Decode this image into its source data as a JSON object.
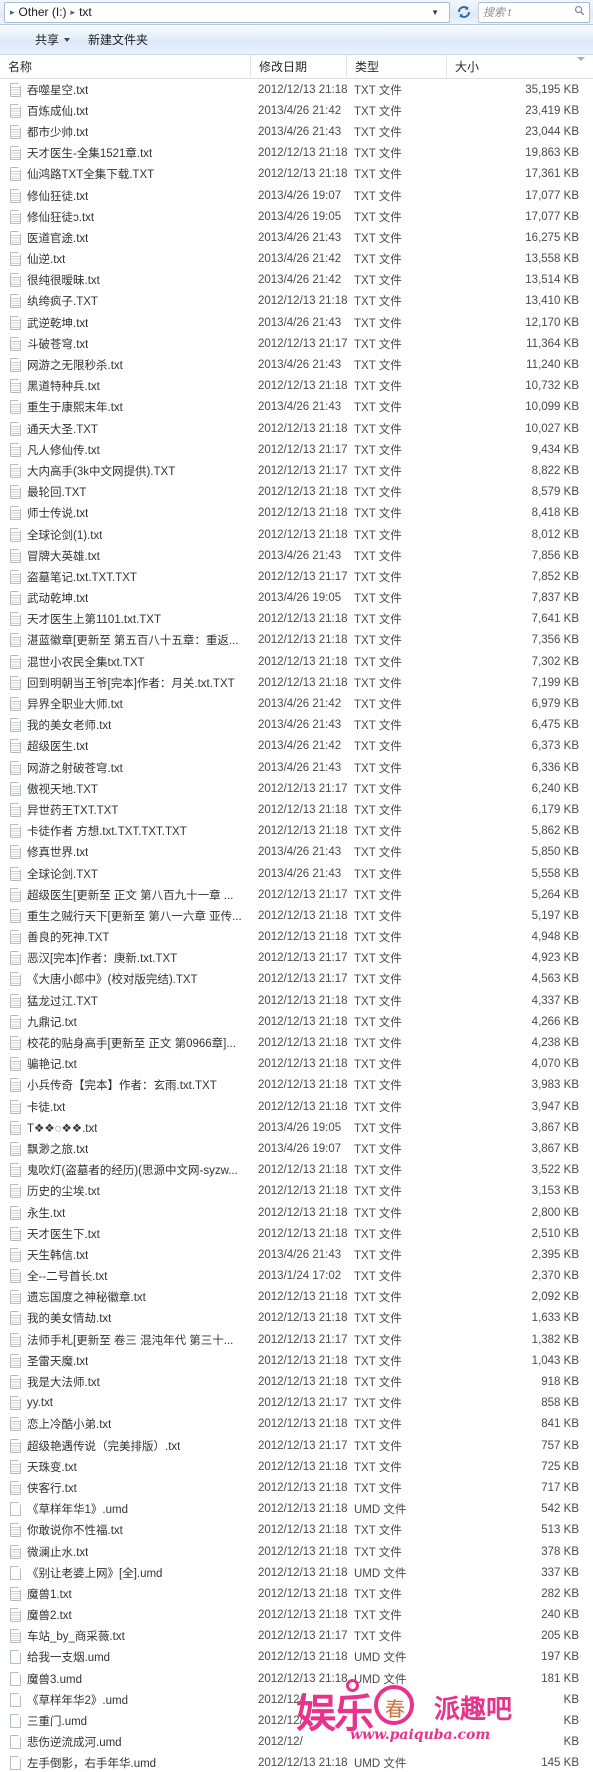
{
  "window": {
    "address": {
      "crumb_root": "Other (I:)",
      "crumb_child": "txt",
      "dropdown_icon": "chevron-down-icon",
      "refresh_icon": "refresh-icon"
    },
    "search": {
      "placeholder": "搜索 t",
      "icon": "search-icon"
    }
  },
  "command_bar": {
    "items": [
      {
        "label": "共享",
        "has_caret": true
      },
      {
        "label": "新建文件夹",
        "has_caret": false
      }
    ]
  },
  "columns": {
    "name": "名称",
    "date": "修改日期",
    "type": "类型",
    "size": "大小",
    "sorted_by": "大小"
  },
  "files": [
    {
      "name": "吞噬星空.txt",
      "date": "2012/12/13 21:18",
      "type": "TXT 文件",
      "size": "35,195 KB",
      "icon": "txt-file-icon"
    },
    {
      "name": "百炼成仙.txt",
      "date": "2013/4/26 21:42",
      "type": "TXT 文件",
      "size": "23,419 KB",
      "icon": "txt-file-icon"
    },
    {
      "name": "都市少帅.txt",
      "date": "2013/4/26 21:43",
      "type": "TXT 文件",
      "size": "23,044 KB",
      "icon": "txt-file-icon"
    },
    {
      "name": "天才医生-全集1521章.txt",
      "date": "2012/12/13 21:18",
      "type": "TXT 文件",
      "size": "19,863 KB",
      "icon": "txt-file-icon"
    },
    {
      "name": "仙鸿路TXT全集下载.TXT",
      "date": "2012/12/13 21:18",
      "type": "TXT 文件",
      "size": "17,361 KB",
      "icon": "txt-file-icon"
    },
    {
      "name": "修仙狂徒.txt",
      "date": "2013/4/26 19:07",
      "type": "TXT 文件",
      "size": "17,077 KB",
      "icon": "txt-file-icon"
    },
    {
      "name": "修仙狂徒ɔ.txt",
      "date": "2013/4/26 19:05",
      "type": "TXT 文件",
      "size": "17,077 KB",
      "icon": "txt-file-icon"
    },
    {
      "name": "医道官途.txt",
      "date": "2013/4/26 21:43",
      "type": "TXT 文件",
      "size": "16,275 KB",
      "icon": "txt-file-icon"
    },
    {
      "name": "仙逆.txt",
      "date": "2013/4/26 21:42",
      "type": "TXT 文件",
      "size": "13,558 KB",
      "icon": "txt-file-icon"
    },
    {
      "name": "很纯很暧昧.txt",
      "date": "2013/4/26 21:42",
      "type": "TXT 文件",
      "size": "13,514 KB",
      "icon": "txt-file-icon"
    },
    {
      "name": "纨绔疯子.TXT",
      "date": "2012/12/13 21:18",
      "type": "TXT 文件",
      "size": "13,410 KB",
      "icon": "txt-file-icon"
    },
    {
      "name": "武逆乾坤.txt",
      "date": "2013/4/26 21:43",
      "type": "TXT 文件",
      "size": "12,170 KB",
      "icon": "txt-file-icon"
    },
    {
      "name": "斗破苍穹.txt",
      "date": "2012/12/13 21:17",
      "type": "TXT 文件",
      "size": "11,364 KB",
      "icon": "txt-file-icon"
    },
    {
      "name": "网游之无限秒杀.txt",
      "date": "2013/4/26 21:43",
      "type": "TXT 文件",
      "size": "11,240 KB",
      "icon": "txt-file-icon"
    },
    {
      "name": "黑道特种兵.txt",
      "date": "2012/12/13 21:18",
      "type": "TXT 文件",
      "size": "10,732 KB",
      "icon": "txt-file-icon"
    },
    {
      "name": "重生于康熙末年.txt",
      "date": "2013/4/26 21:43",
      "type": "TXT 文件",
      "size": "10,099 KB",
      "icon": "txt-file-icon"
    },
    {
      "name": "通天大圣.TXT",
      "date": "2012/12/13 21:18",
      "type": "TXT 文件",
      "size": "10,027 KB",
      "icon": "txt-file-icon"
    },
    {
      "name": "凡人修仙传.txt",
      "date": "2012/12/13 21:17",
      "type": "TXT 文件",
      "size": "9,434 KB",
      "icon": "txt-file-icon"
    },
    {
      "name": "大内高手(3k中文网提供).TXT",
      "date": "2012/12/13 21:17",
      "type": "TXT 文件",
      "size": "8,822 KB",
      "icon": "txt-file-icon"
    },
    {
      "name": "最轮回.TXT",
      "date": "2012/12/13 21:18",
      "type": "TXT 文件",
      "size": "8,579 KB",
      "icon": "txt-file-icon"
    },
    {
      "name": "师士传说.txt",
      "date": "2012/12/13 21:18",
      "type": "TXT 文件",
      "size": "8,418 KB",
      "icon": "txt-file-icon"
    },
    {
      "name": "全球论剑(1).txt",
      "date": "2012/12/13 21:18",
      "type": "TXT 文件",
      "size": "8,012 KB",
      "icon": "txt-file-icon"
    },
    {
      "name": "冒牌大英雄.txt",
      "date": "2013/4/26 21:43",
      "type": "TXT 文件",
      "size": "7,856 KB",
      "icon": "txt-file-icon"
    },
    {
      "name": "盗墓笔记.txt.TXT.TXT",
      "date": "2012/12/13 21:17",
      "type": "TXT 文件",
      "size": "7,852 KB",
      "icon": "txt-file-icon"
    },
    {
      "name": "武动乾坤.txt",
      "date": "2013/4/26 19:05",
      "type": "TXT 文件",
      "size": "7,837 KB",
      "icon": "txt-file-icon"
    },
    {
      "name": "天才医生上第1101.txt.TXT",
      "date": "2012/12/13 21:18",
      "type": "TXT 文件",
      "size": "7,641 KB",
      "icon": "txt-file-icon"
    },
    {
      "name": "湛蓝徽章[更新至 第五百八十五章：重返...",
      "date": "2012/12/13 21:18",
      "type": "TXT 文件",
      "size": "7,356 KB",
      "icon": "txt-file-icon"
    },
    {
      "name": "混世小农民全集txt.TXT",
      "date": "2012/12/13 21:18",
      "type": "TXT 文件",
      "size": "7,302 KB",
      "icon": "txt-file-icon"
    },
    {
      "name": "回到明朝当王爷[完本]作者：月关.txt.TXT",
      "date": "2012/12/13 21:18",
      "type": "TXT 文件",
      "size": "7,199 KB",
      "icon": "txt-file-icon"
    },
    {
      "name": "异界全职业大师.txt",
      "date": "2013/4/26 21:42",
      "type": "TXT 文件",
      "size": "6,979 KB",
      "icon": "txt-file-icon"
    },
    {
      "name": "我的美女老师.txt",
      "date": "2013/4/26 21:43",
      "type": "TXT 文件",
      "size": "6,475 KB",
      "icon": "txt-file-icon"
    },
    {
      "name": "超级医生.txt",
      "date": "2013/4/26 21:42",
      "type": "TXT 文件",
      "size": "6,373 KB",
      "icon": "txt-file-icon"
    },
    {
      "name": "网游之射破苍穹.txt",
      "date": "2013/4/26 21:43",
      "type": "TXT 文件",
      "size": "6,336 KB",
      "icon": "txt-file-icon"
    },
    {
      "name": "傲视天地.TXT",
      "date": "2012/12/13 21:17",
      "type": "TXT 文件",
      "size": "6,240 KB",
      "icon": "txt-file-icon"
    },
    {
      "name": "异世药王TXT.TXT",
      "date": "2012/12/13 21:18",
      "type": "TXT 文件",
      "size": "6,179 KB",
      "icon": "txt-file-icon"
    },
    {
      "name": "卡徒作者 方想.txt.TXT.TXT.TXT",
      "date": "2012/12/13 21:18",
      "type": "TXT 文件",
      "size": "5,862 KB",
      "icon": "txt-file-icon"
    },
    {
      "name": "修真世界.txt",
      "date": "2013/4/26 21:43",
      "type": "TXT 文件",
      "size": "5,850 KB",
      "icon": "txt-file-icon"
    },
    {
      "name": "全球论剑.TXT",
      "date": "2013/4/26 21:43",
      "type": "TXT 文件",
      "size": "5,558 KB",
      "icon": "txt-file-icon"
    },
    {
      "name": "超级医生[更新至 正文 第八百九十一章 ...",
      "date": "2012/12/13 21:17",
      "type": "TXT 文件",
      "size": "5,264 KB",
      "icon": "txt-file-icon"
    },
    {
      "name": "重生之贼行天下[更新至 第八一六章 亚传...",
      "date": "2012/12/13 21:18",
      "type": "TXT 文件",
      "size": "5,197 KB",
      "icon": "txt-file-icon"
    },
    {
      "name": "善良的死神.TXT",
      "date": "2012/12/13 21:18",
      "type": "TXT 文件",
      "size": "4,948 KB",
      "icon": "txt-file-icon"
    },
    {
      "name": "恶汉[完本]作者：庚新.txt.TXT",
      "date": "2012/12/13 21:17",
      "type": "TXT 文件",
      "size": "4,923 KB",
      "icon": "txt-file-icon"
    },
    {
      "name": "《大唐小郎中》(校对版完结).TXT",
      "date": "2012/12/13 21:17",
      "type": "TXT 文件",
      "size": "4,563 KB",
      "icon": "txt-file-icon"
    },
    {
      "name": "猛龙过江.TXT",
      "date": "2012/12/13 21:18",
      "type": "TXT 文件",
      "size": "4,337 KB",
      "icon": "txt-file-icon"
    },
    {
      "name": "九鼎记.txt",
      "date": "2012/12/13 21:18",
      "type": "TXT 文件",
      "size": "4,266 KB",
      "icon": "txt-file-icon"
    },
    {
      "name": "校花的贴身高手[更新至 正文 第0966章]...",
      "date": "2012/12/13 21:18",
      "type": "TXT 文件",
      "size": "4,238 KB",
      "icon": "txt-file-icon"
    },
    {
      "name": "骗艳记.txt",
      "date": "2012/12/13 21:18",
      "type": "TXT 文件",
      "size": "4,070 KB",
      "icon": "txt-file-icon"
    },
    {
      "name": "小兵传奇【完本】作者：玄雨.txt.TXT",
      "date": "2012/12/13 21:18",
      "type": "TXT 文件",
      "size": "3,983 KB",
      "icon": "txt-file-icon"
    },
    {
      "name": "卡徒.txt",
      "date": "2012/12/13 21:18",
      "type": "TXT 文件",
      "size": "3,947 KB",
      "icon": "txt-file-icon"
    },
    {
      "name": "T❖❖◌❖❖.txt",
      "date": "2013/4/26 19:05",
      "type": "TXT 文件",
      "size": "3,867 KB",
      "icon": "txt-file-icon"
    },
    {
      "name": "飘渺之旅.txt",
      "date": "2013/4/26 19:07",
      "type": "TXT 文件",
      "size": "3,867 KB",
      "icon": "txt-file-icon"
    },
    {
      "name": "鬼吹灯(盗墓者的经历)(思源中文网-syzw...",
      "date": "2012/12/13 21:18",
      "type": "TXT 文件",
      "size": "3,522 KB",
      "icon": "txt-file-icon"
    },
    {
      "name": "历史的尘埃.txt",
      "date": "2012/12/13 21:18",
      "type": "TXT 文件",
      "size": "3,153 KB",
      "icon": "txt-file-icon"
    },
    {
      "name": "永生.txt",
      "date": "2012/12/13 21:18",
      "type": "TXT 文件",
      "size": "2,800 KB",
      "icon": "txt-file-icon"
    },
    {
      "name": "天才医生下.txt",
      "date": "2012/12/13 21:18",
      "type": "TXT 文件",
      "size": "2,510 KB",
      "icon": "txt-file-icon"
    },
    {
      "name": "天生韩信.txt",
      "date": "2013/4/26 21:43",
      "type": "TXT 文件",
      "size": "2,395 KB",
      "icon": "txt-file-icon"
    },
    {
      "name": "全--二号首长.txt",
      "date": "2013/1/24 17:02",
      "type": "TXT 文件",
      "size": "2,370 KB",
      "icon": "txt-file-icon"
    },
    {
      "name": "遗忘国度之神秘徽章.txt",
      "date": "2012/12/13 21:18",
      "type": "TXT 文件",
      "size": "2,092 KB",
      "icon": "txt-file-icon"
    },
    {
      "name": "我的美女情劫.txt",
      "date": "2012/12/13 21:18",
      "type": "TXT 文件",
      "size": "1,633 KB",
      "icon": "txt-file-icon"
    },
    {
      "name": "法师手札[更新至 卷三 混沌年代 第三十...",
      "date": "2012/12/13 21:17",
      "type": "TXT 文件",
      "size": "1,382 KB",
      "icon": "txt-file-icon"
    },
    {
      "name": "圣雷天魔.txt",
      "date": "2012/12/13 21:18",
      "type": "TXT 文件",
      "size": "1,043 KB",
      "icon": "txt-file-icon"
    },
    {
      "name": "我是大法师.txt",
      "date": "2012/12/13 21:18",
      "type": "TXT 文件",
      "size": "918 KB",
      "icon": "txt-file-icon"
    },
    {
      "name": "yy.txt",
      "date": "2012/12/13 21:17",
      "type": "TXT 文件",
      "size": "858 KB",
      "icon": "txt-file-icon"
    },
    {
      "name": "恋上冷酷小弟.txt",
      "date": "2012/12/13 21:18",
      "type": "TXT 文件",
      "size": "841 KB",
      "icon": "txt-file-icon"
    },
    {
      "name": "超级艳遇传说（完美排版）.txt",
      "date": "2012/12/13 21:17",
      "type": "TXT 文件",
      "size": "757 KB",
      "icon": "txt-file-icon"
    },
    {
      "name": "天珠变.txt",
      "date": "2012/12/13 21:18",
      "type": "TXT 文件",
      "size": "725 KB",
      "icon": "txt-file-icon"
    },
    {
      "name": "侠客行.txt",
      "date": "2012/12/13 21:18",
      "type": "TXT 文件",
      "size": "717 KB",
      "icon": "txt-file-icon"
    },
    {
      "name": "《草样年华1》.umd",
      "date": "2012/12/13 21:18",
      "type": "UMD 文件",
      "size": "542 KB",
      "icon": "umd-file-icon"
    },
    {
      "name": "你敢说你不性福.txt",
      "date": "2012/12/13 21:18",
      "type": "TXT 文件",
      "size": "513 KB",
      "icon": "txt-file-icon"
    },
    {
      "name": "微澜止水.txt",
      "date": "2012/12/13 21:18",
      "type": "TXT 文件",
      "size": "378 KB",
      "icon": "txt-file-icon"
    },
    {
      "name": "《别让老婆上网》[全].umd",
      "date": "2012/12/13 21:18",
      "type": "UMD 文件",
      "size": "337 KB",
      "icon": "umd-file-icon"
    },
    {
      "name": "魔兽1.txt",
      "date": "2012/12/13 21:18",
      "type": "TXT 文件",
      "size": "282 KB",
      "icon": "txt-file-icon"
    },
    {
      "name": "魔兽2.txt",
      "date": "2012/12/13 21:18",
      "type": "TXT 文件",
      "size": "240 KB",
      "icon": "txt-file-icon"
    },
    {
      "name": "车站_by_商采薇.txt",
      "date": "2012/12/13 21:17",
      "type": "TXT 文件",
      "size": "205 KB",
      "icon": "txt-file-icon"
    },
    {
      "name": "给我一支烟.umd",
      "date": "2012/12/13 21:18",
      "type": "UMD 文件",
      "size": "197 KB",
      "icon": "umd-file-icon"
    },
    {
      "name": "魔兽3.umd",
      "date": "2012/12/13 21:18",
      "type": "UMD 文件",
      "size": "181 KB",
      "icon": "umd-file-icon"
    },
    {
      "name": "《草样年华2》.umd",
      "date": "2012/12/",
      "type": "",
      "size": "KB",
      "icon": "umd-file-icon"
    },
    {
      "name": "三重门.umd",
      "date": "2012/12/",
      "type": "",
      "size": "KB",
      "icon": "umd-file-icon"
    },
    {
      "name": "悲伤逆流成河.umd",
      "date": "2012/12/",
      "type": "",
      "size": "KB",
      "icon": "umd-file-icon"
    },
    {
      "name": "左手倒影，右手年华.umd",
      "date": "2012/12/13 21:18",
      "type": "UMD 文件",
      "size": "145 KB",
      "icon": "umd-file-icon"
    }
  ],
  "watermark": {
    "brand_cn": "娱乐",
    "brand_cn2": "春",
    "brand_right": "派趣吧",
    "url": "www.paiquba.com",
    "color": "#e8338c"
  }
}
